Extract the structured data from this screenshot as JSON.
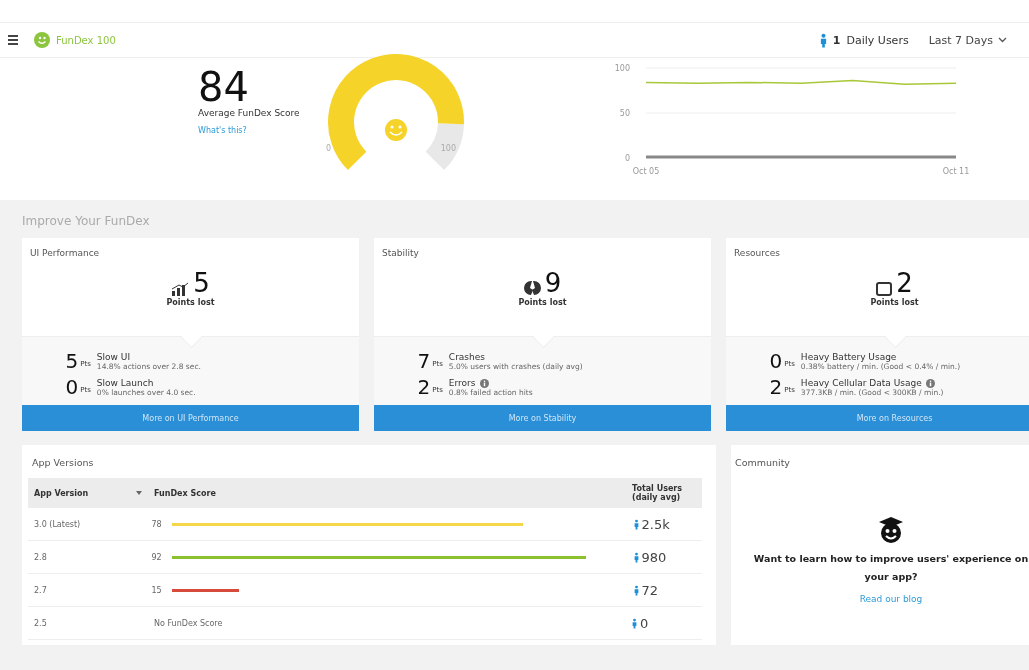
{
  "header": {
    "app_name": "FunDex 100",
    "daily_users_count": "1",
    "daily_users_label": "Daily Users",
    "period": "Last 7 Days"
  },
  "score": {
    "value": "84",
    "label": "Average FunDex Score",
    "link": "What's this?",
    "gauge_min": "0",
    "gauge_max": "100"
  },
  "trend": {
    "chart_data": {
      "type": "line",
      "x": [
        "Oct 05",
        null,
        null,
        null,
        null,
        null,
        "Oct 11"
      ],
      "ylim": [
        0,
        100
      ],
      "yticks": [
        0,
        50,
        100
      ],
      "series": [
        {
          "color": "#a8c83a",
          "values": [
            84,
            83,
            84,
            83,
            86,
            82,
            83
          ]
        },
        {
          "color": "#888888",
          "values": [
            1,
            1,
            1,
            1,
            1,
            1,
            1
          ]
        }
      ]
    }
  },
  "improve": {
    "title": "Improve Your FunDex",
    "cards": [
      {
        "title": "UI Performance",
        "points": "5",
        "points_label": "Points lost",
        "button": "More on UI Performance",
        "items": [
          {
            "points": "5",
            "unit": "Pts",
            "name": "Slow UI",
            "detail": "14.8% actions over 2.8 sec.",
            "info": false
          },
          {
            "points": "0",
            "unit": "Pts",
            "name": "Slow Launch",
            "detail": "0% launches over 4.0 sec.",
            "info": false
          }
        ]
      },
      {
        "title": "Stability",
        "points": "9",
        "points_label": "Points lost",
        "button": "More on Stability",
        "items": [
          {
            "points": "7",
            "unit": "Pts",
            "name": "Crashes",
            "detail": "5.0% users with crashes (daily avg)",
            "info": false
          },
          {
            "points": "2",
            "unit": "Pts",
            "name": "Errors",
            "detail": "0.8% failed action hits",
            "info": true
          }
        ]
      },
      {
        "title": "Resources",
        "points": "2",
        "points_label": "Points lost",
        "button": "More on Resources",
        "items": [
          {
            "points": "0",
            "unit": "Pts",
            "name": "Heavy Battery Usage",
            "detail": "0.38% battery / min. (Good < 0.4% / min.)",
            "info": false
          },
          {
            "points": "2",
            "unit": "Pts",
            "name": "Heavy Cellular Data Usage",
            "detail": "377.3KB / min. (Good < 300KB / min.)",
            "info": true
          }
        ]
      }
    ]
  },
  "versions": {
    "title": "App Versions",
    "columns": [
      "App Version",
      "FunDex Score",
      "Total Users (daily avg)"
    ],
    "rows": [
      {
        "version": "3.0 (Latest)",
        "score": "78",
        "color": "#f4d84a",
        "users": "2.5k"
      },
      {
        "version": "2.8",
        "score": "92",
        "color": "#8cc02c",
        "users": "980"
      },
      {
        "version": "2.7",
        "score": "15",
        "color": "#d84a3a",
        "users": "72"
      },
      {
        "version": "2.5",
        "score": "No FunDex Score",
        "users": "0"
      }
    ]
  },
  "community": {
    "title": "Community",
    "text": "Want to learn how to improve users' experience on your app?",
    "link": "Read our blog"
  }
}
